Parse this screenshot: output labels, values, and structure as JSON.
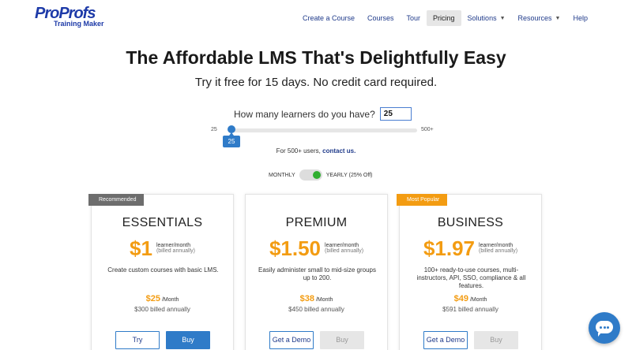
{
  "logo": {
    "main": "ProProfs",
    "sub": "Training Maker"
  },
  "nav": {
    "items": [
      {
        "label": "Create a Course",
        "caret": false,
        "active": false
      },
      {
        "label": "Courses",
        "caret": false,
        "active": false
      },
      {
        "label": "Tour",
        "caret": false,
        "active": false
      },
      {
        "label": "Pricing",
        "caret": false,
        "active": true
      },
      {
        "label": "Solutions",
        "caret": true,
        "active": false
      },
      {
        "label": "Resources",
        "caret": true,
        "active": false
      },
      {
        "label": "Help",
        "caret": false,
        "active": false
      }
    ]
  },
  "hero": {
    "title": "The Affordable LMS That's Delightfully Easy",
    "subtitle": "Try it free for 15 days. No credit card required."
  },
  "learners": {
    "question": "How many learners do you have?",
    "value": "25",
    "slider_min": "25",
    "slider_max": "500+",
    "slider_value": "25",
    "contact_prefix": "For 500+ users,",
    "contact_link": "contact us."
  },
  "billing": {
    "monthly_label": "MONTHLY",
    "yearly_label": "YEARLY (25% Off)",
    "yearly_selected": true
  },
  "plans": [
    {
      "ribbon": "Recommended",
      "name": "ESSENTIALS",
      "price": "$1",
      "unit_a": "learner/month",
      "unit_b": "(billed annually)",
      "desc": "Create custom courses with basic LMS.",
      "monthly": "$25",
      "monthly_unit": "/Month",
      "billed": "$300 billed annually",
      "btn1": "Try",
      "btn2": "Buy"
    },
    {
      "ribbon": "",
      "name": "PREMIUM",
      "price": "$1.50",
      "unit_a": "learner/month",
      "unit_b": "(billed annually)",
      "desc": "Easily administer small to mid-size groups up to 200.",
      "monthly": "$38",
      "monthly_unit": "/Month",
      "billed": "$450 billed annually",
      "btn1": "Get a Demo",
      "btn2": "Buy"
    },
    {
      "ribbon": "Most Popular",
      "name": "BUSINESS",
      "price": "$1.97",
      "unit_a": "learner/month",
      "unit_b": "(billed annually)",
      "desc": "100+ ready-to-use courses, multi-instructors, API, SSO, compliance & all features.",
      "monthly": "$49",
      "monthly_unit": "/Month",
      "billed": "$591 billed annually",
      "btn1": "Get a Demo",
      "btn2": "Buy"
    }
  ],
  "colors": {
    "brand": "#1d3aa8",
    "accent": "#2f7bc8",
    "price": "#f39c12",
    "toggle_on": "#2fae2f"
  },
  "icons": {
    "chat": "chat-icon"
  }
}
